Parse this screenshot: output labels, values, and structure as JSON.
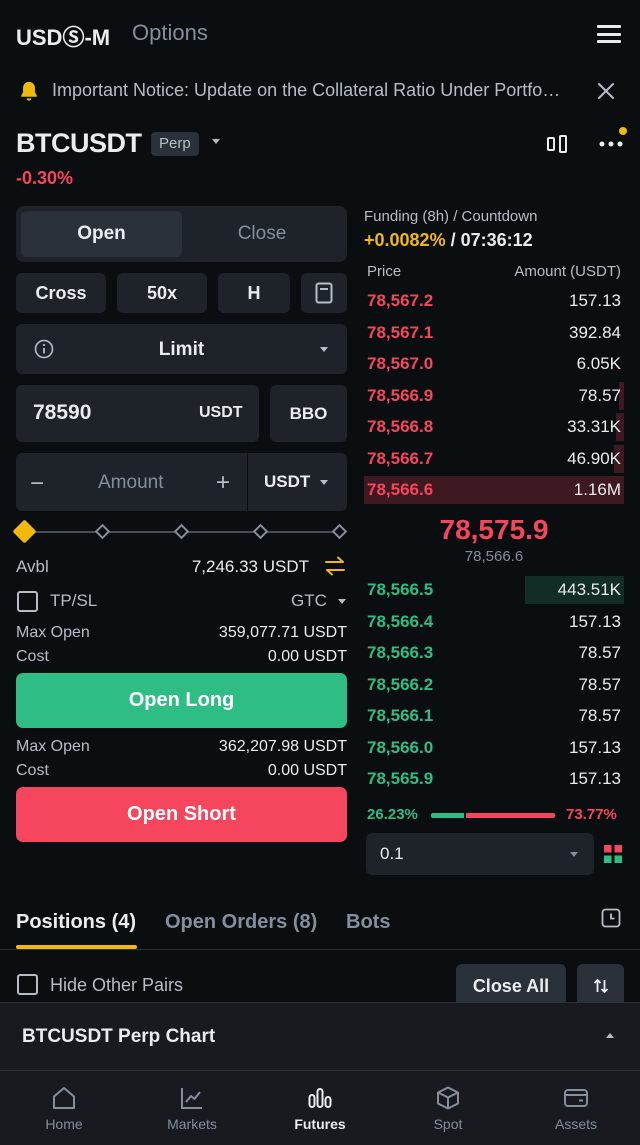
{
  "header": {
    "tabs": [
      "USDⓈ-M",
      "Options"
    ]
  },
  "notice": {
    "text": "Important Notice: Update on the Collateral Ratio Under Portfolio Margin Mode"
  },
  "symbol": {
    "name": "BTCUSDT",
    "badge": "Perp",
    "change": "-0.30%"
  },
  "order_form": {
    "tabs": {
      "open": "Open",
      "close": "Close"
    },
    "margin_mode": "Cross",
    "leverage": "50x",
    "position_mode": "H",
    "order_type": "Limit",
    "price": {
      "value": "78590",
      "unit": "USDT"
    },
    "bbo_label": "BBO",
    "amount": {
      "placeholder": "Amount",
      "unit": "USDT",
      "minus": "−",
      "plus": "+"
    },
    "slider_level": 0,
    "avbl": {
      "label": "Avbl",
      "value": "7,246.33 USDT"
    },
    "tpsl_label": "TP/SL",
    "time_in_force": "GTC",
    "long": {
      "max_open_label": "Max Open",
      "max_open_value": "359,077.71 USDT",
      "cost_label": "Cost",
      "cost_value": "0.00 USDT",
      "button": "Open Long"
    },
    "short": {
      "max_open_label": "Max Open",
      "max_open_value": "362,207.98 USDT",
      "cost_label": "Cost",
      "cost_value": "0.00 USDT",
      "button": "Open Short"
    }
  },
  "funding": {
    "label": "Funding (8h) / Countdown",
    "rate": "+0.0082%",
    "separator": " / ",
    "countdown": "07:36:12"
  },
  "orderbook": {
    "headers": {
      "price": "Price",
      "amount": "Amount (USDT)"
    },
    "asks": [
      {
        "price": "78,567.2",
        "amount": "157.13",
        "depth": 0
      },
      {
        "price": "78,567.1",
        "amount": "392.84",
        "depth": 0
      },
      {
        "price": "78,567.0",
        "amount": "6.05K",
        "depth": 0
      },
      {
        "price": "78,566.9",
        "amount": "78.57",
        "depth": 0.02
      },
      {
        "price": "78,566.8",
        "amount": "33.31K",
        "depth": 0.03
      },
      {
        "price": "78,566.7",
        "amount": "46.90K",
        "depth": 0.04
      },
      {
        "price": "78,566.6",
        "amount": "1.16M",
        "depth": 1.0
      }
    ],
    "last_price": "78,575.9",
    "mark_price": "78,566.6",
    "bids": [
      {
        "price": "78,566.5",
        "amount": "443.51K",
        "depth": 0.38
      },
      {
        "price": "78,566.4",
        "amount": "157.13",
        "depth": 0
      },
      {
        "price": "78,566.3",
        "amount": "78.57",
        "depth": 0
      },
      {
        "price": "78,566.2",
        "amount": "78.57",
        "depth": 0
      },
      {
        "price": "78,566.1",
        "amount": "78.57",
        "depth": 0
      },
      {
        "price": "78,566.0",
        "amount": "157.13",
        "depth": 0
      },
      {
        "price": "78,565.9",
        "amount": "157.13",
        "depth": 0
      }
    ],
    "buy_ratio": "26.23%",
    "sell_ratio": "73.77%",
    "buy_fraction": 0.2623,
    "depth_step": "0.1"
  },
  "positions": {
    "tabs": [
      "Positions (4)",
      "Open Orders (8)",
      "Bots"
    ],
    "hide_other_pairs": "Hide Other Pairs",
    "close_all": "Close All"
  },
  "chart_sheet": {
    "title": "BTCUSDT Perp Chart"
  },
  "bottom_nav": [
    {
      "label": "Home",
      "icon": "home-icon"
    },
    {
      "label": "Markets",
      "icon": "markets-icon"
    },
    {
      "label": "Futures",
      "icon": "futures-icon",
      "active": true
    },
    {
      "label": "Spot",
      "icon": "spot-icon"
    },
    {
      "label": "Assets",
      "icon": "wallet-icon"
    }
  ],
  "colors": {
    "background": "#0b0e11",
    "panel": "#1e2329",
    "accent": "#f0b90b",
    "buy": "#2ebd85",
    "sell": "#f6465d"
  }
}
